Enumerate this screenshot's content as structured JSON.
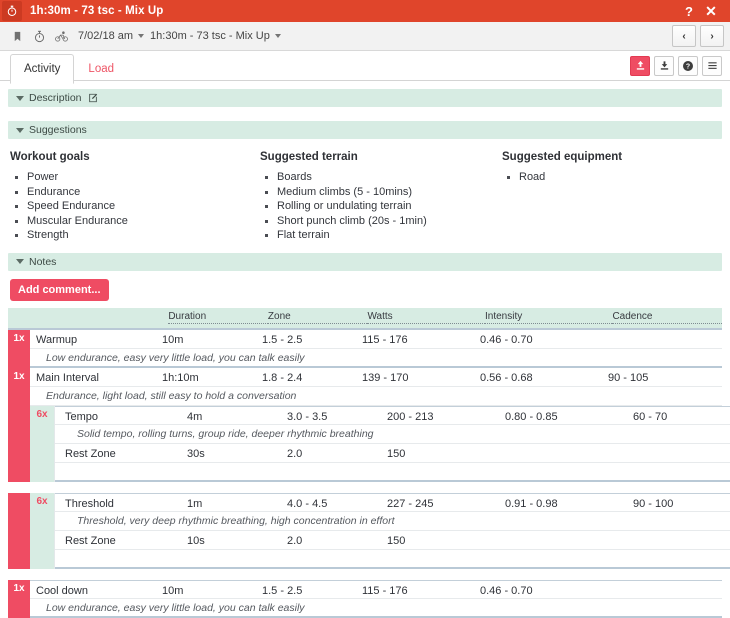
{
  "titlebar": {
    "icon": "stopwatch-icon",
    "title": "1h:30m - 73 tsc - Mix Up",
    "help_label": "?",
    "close_label": "✕"
  },
  "subbar": {
    "icons": [
      "bookmark-icon",
      "stopwatch-icon",
      "cyclist-icon"
    ],
    "date": "7/02/18 am",
    "workout": "1h:30m - 73 tsc - Mix Up",
    "prev_label": "‹",
    "next_label": "›"
  },
  "tabs": [
    {
      "label": "Activity",
      "active": true
    },
    {
      "label": "Load",
      "active": false
    }
  ],
  "toolbuttons": [
    {
      "name": "upload-icon",
      "primary": true
    },
    {
      "name": "download-icon",
      "primary": false
    },
    {
      "name": "help-icon",
      "primary": false
    },
    {
      "name": "menu-icon",
      "primary": false
    }
  ],
  "sections": {
    "description": "Description",
    "suggestions": "Suggestions",
    "notes": "Notes"
  },
  "suggestions": {
    "columns": [
      {
        "title": "Workout goals",
        "items": [
          "Power",
          "Endurance",
          "Speed Endurance",
          "Muscular Endurance",
          "Strength"
        ]
      },
      {
        "title": "Suggested terrain",
        "items": [
          "Boards",
          "Medium climbs (5 - 10mins)",
          "Rolling or undulating terrain",
          "Short punch climb (20s - 1min)",
          "Flat terrain"
        ]
      },
      {
        "title": "Suggested equipment",
        "items": [
          "Road"
        ]
      }
    ]
  },
  "comment_button": "Add comment...",
  "table": {
    "headers": [
      "Duration",
      "Zone",
      "Watts",
      "Intensity",
      "Cadence"
    ],
    "blocks": [
      {
        "reps": "1x",
        "nested": false,
        "rows": [
          {
            "name": "Warmup",
            "duration": "10m",
            "zone": "1.5 - 2.5",
            "watts": "115 - 176",
            "intensity": "0.46 - 0.70",
            "cadence": "",
            "description": "Low endurance, easy very little load, you can talk easily"
          }
        ]
      },
      {
        "reps": "1x",
        "nested": false,
        "rows": [
          {
            "name": "Main Interval",
            "duration": "1h:10m",
            "zone": "1.8 - 2.4",
            "watts": "139 - 170",
            "intensity": "0.56 - 0.68",
            "cadence": "90 - 105",
            "description": "Endurance, light load, still easy to hold a conversation"
          }
        ]
      },
      {
        "reps": "",
        "inner_reps": "6x",
        "nested": true,
        "rows": [
          {
            "name": "Tempo",
            "duration": "4m",
            "zone": "3.0 - 3.5",
            "watts": "200 - 213",
            "intensity": "0.80 - 0.85",
            "cadence": "60 - 70",
            "description": "Solid tempo, rolling turns, group ride, deeper rhythmic breathing"
          },
          {
            "name": "Rest Zone",
            "duration": "30s",
            "zone": "2.0",
            "watts": "150",
            "intensity": "",
            "cadence": "",
            "description": ""
          }
        ]
      },
      {
        "reps": "",
        "inner_reps": "6x",
        "nested": true,
        "rows": [
          {
            "name": "Threshold",
            "duration": "1m",
            "zone": "4.0 - 4.5",
            "watts": "227 - 245",
            "intensity": "0.91 - 0.98",
            "cadence": "90 - 100",
            "description": "Threshold, very deep rhythmic breathing, high concentration in effort"
          },
          {
            "name": "Rest Zone",
            "duration": "10s",
            "zone": "2.0",
            "watts": "150",
            "intensity": "",
            "cadence": "",
            "description": ""
          }
        ]
      },
      {
        "reps": "1x",
        "nested": false,
        "rows": [
          {
            "name": "Cool down",
            "duration": "10m",
            "zone": "1.5 - 2.5",
            "watts": "115 - 176",
            "intensity": "0.46 - 0.70",
            "cadence": "",
            "description": "Low endurance, easy very little load, you can talk easily"
          }
        ]
      }
    ]
  },
  "colors": {
    "titlebar": "#e0452b",
    "accent_red": "#ef4c63",
    "section_green": "#d7ece3"
  }
}
